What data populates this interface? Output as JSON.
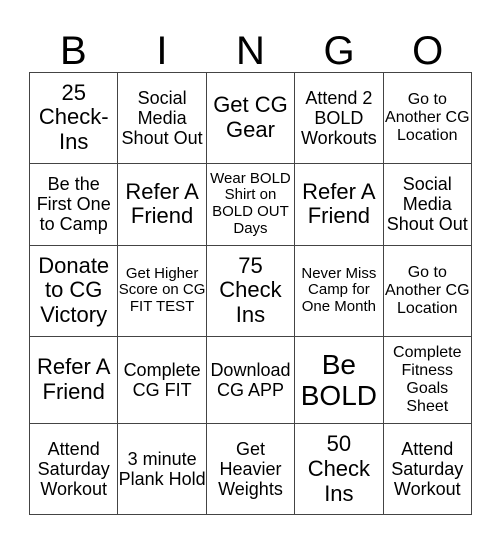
{
  "header": [
    "B",
    "I",
    "N",
    "G",
    "O"
  ],
  "rows": [
    [
      "25 Check-Ins",
      "Social Media Shout Out",
      "Get CG Gear",
      "Attend 2 BOLD Workouts",
      "Go to Another CG Location"
    ],
    [
      "Be the First One to Camp",
      "Refer A Friend",
      "Wear BOLD Shirt on BOLD OUT Days",
      "Refer A Friend",
      "Social Media Shout Out"
    ],
    [
      "Donate to CG Victory",
      "Get Higher Score on CG FIT TEST",
      "75 Check Ins",
      "Never Miss Camp for One Month",
      "Go to Another CG Location"
    ],
    [
      "Refer A Friend",
      "Complete CG FIT",
      "Download CG APP",
      "Be BOLD",
      "Complete Fitness Goals Sheet"
    ],
    [
      "Attend Saturday Workout",
      "3 minute Plank Hold",
      "Get Heavier Weights",
      "50 Check Ins",
      "Attend Saturday Workout"
    ]
  ]
}
